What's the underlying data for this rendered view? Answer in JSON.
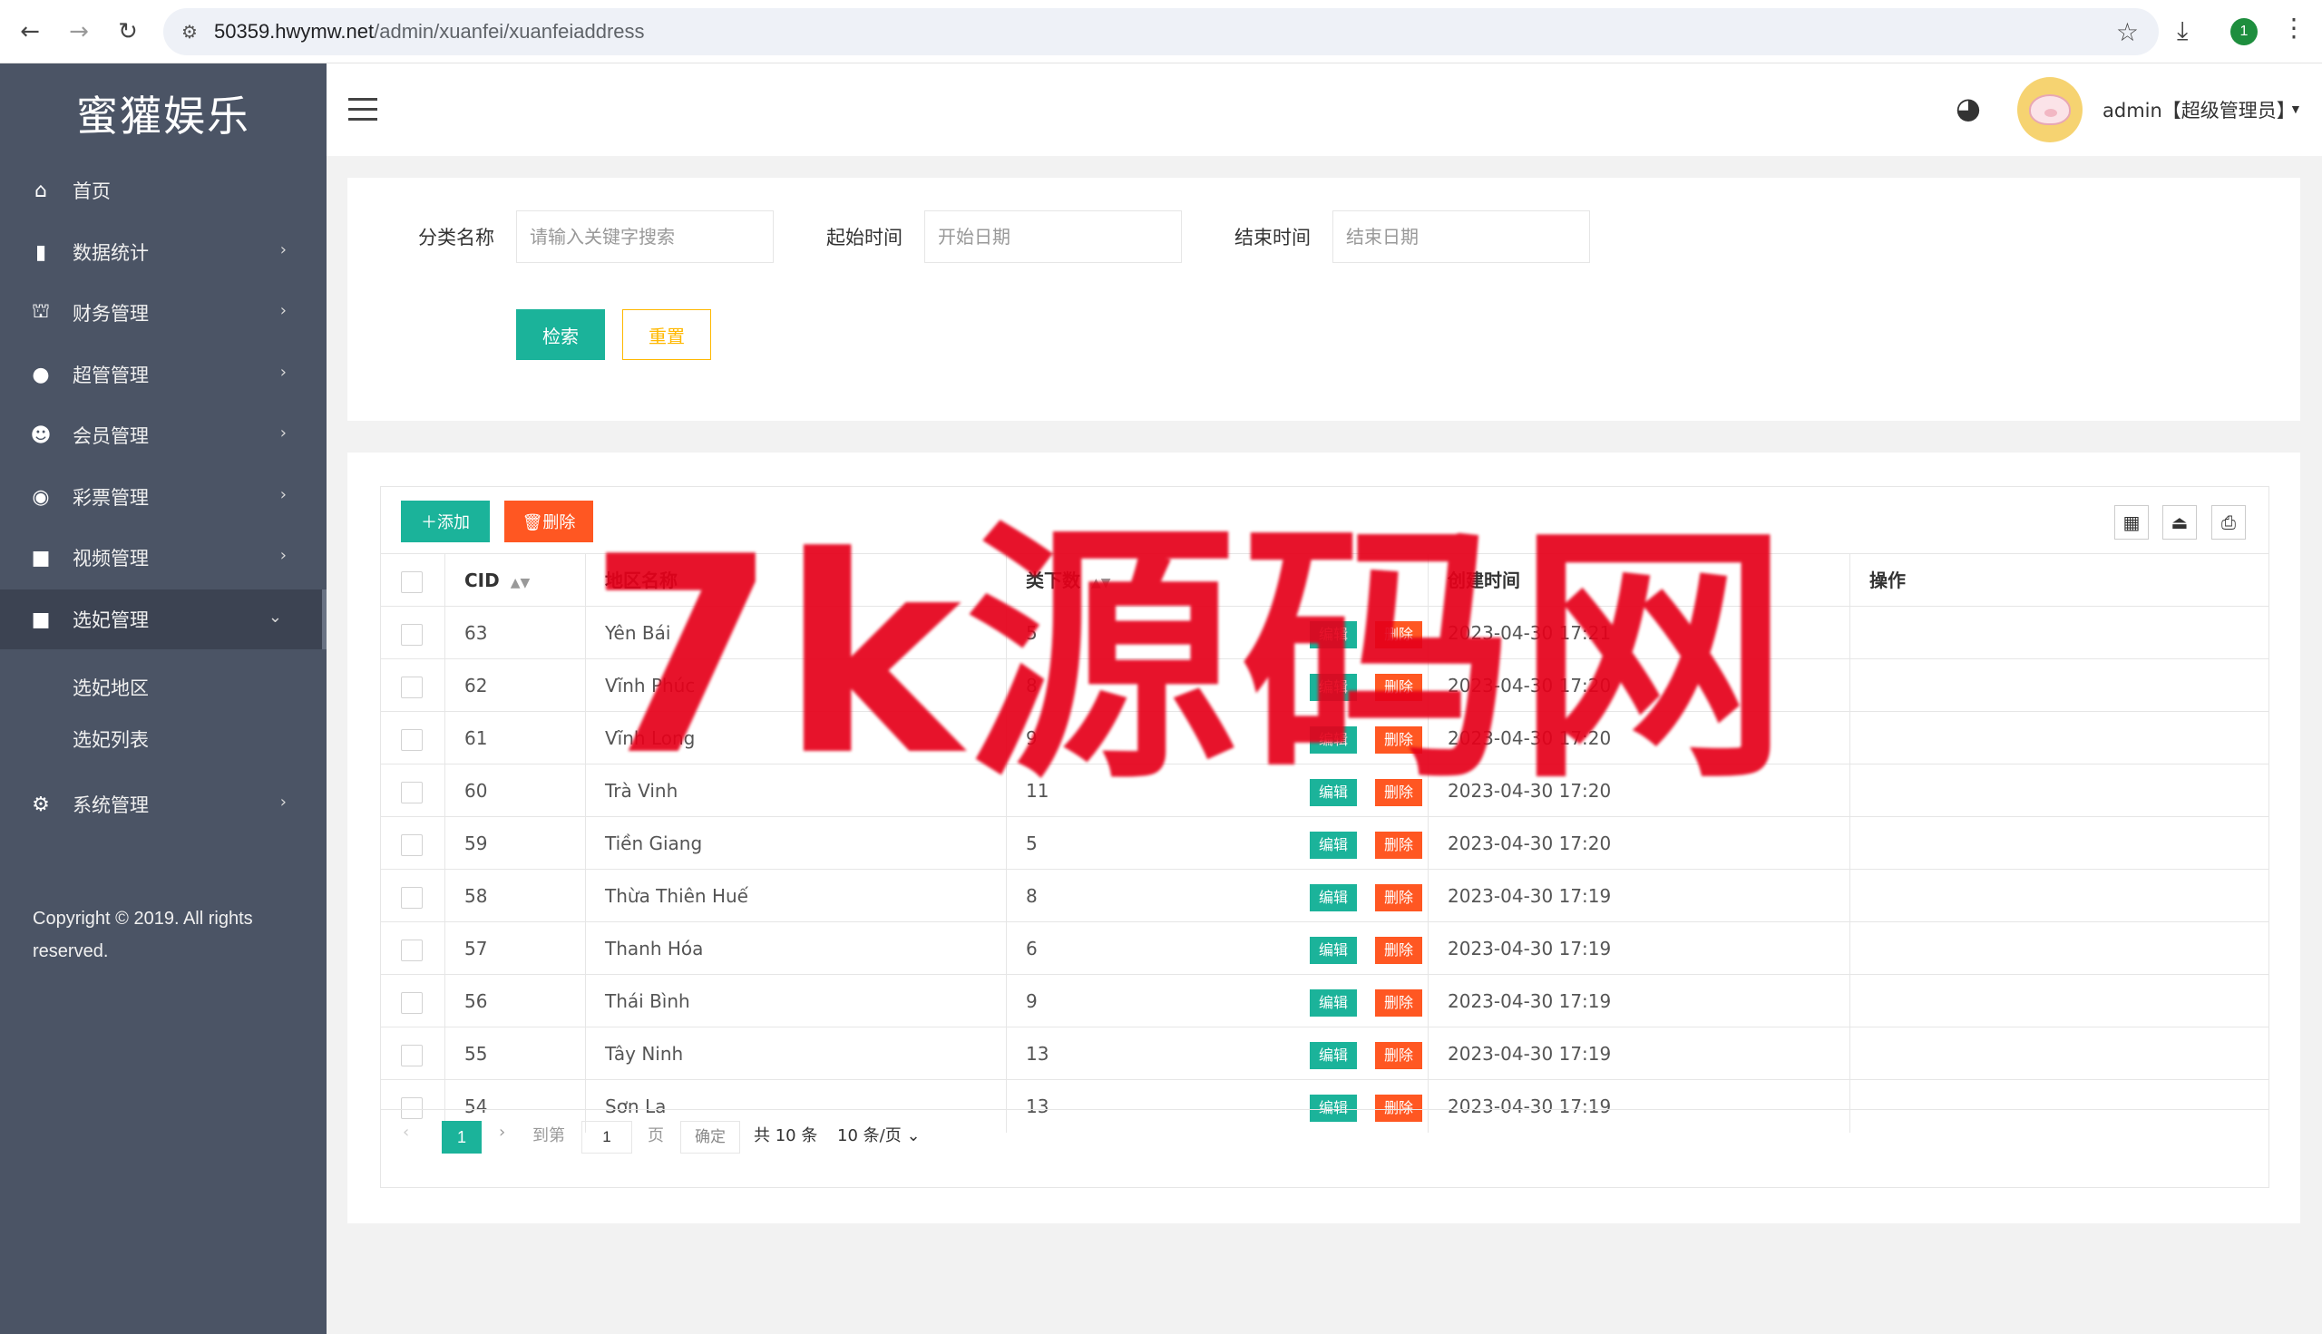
{
  "browser": {
    "url_host": "50359.hwymw.net",
    "url_path": "/admin/xuanfei/xuanfeiaddress",
    "profile_badge": "1"
  },
  "sidebar": {
    "logo": "蜜獾娱乐",
    "items": [
      {
        "label": "首页",
        "icon": "home-icon",
        "glyph": "⌂"
      },
      {
        "label": "数据统计",
        "icon": "bar-chart-icon",
        "glyph": "▮"
      },
      {
        "label": "财务管理",
        "icon": "bank-icon",
        "glyph": "⛫"
      },
      {
        "label": "超管管理",
        "icon": "user-icon",
        "glyph": "●"
      },
      {
        "label": "会员管理",
        "icon": "users-icon",
        "glyph": "☻"
      },
      {
        "label": "彩票管理",
        "icon": "gamepad-icon",
        "glyph": "◉"
      },
      {
        "label": "视频管理",
        "icon": "video-camera-icon",
        "glyph": "■"
      },
      {
        "label": "选妃管理",
        "icon": "video-camera-icon",
        "glyph": "■"
      },
      {
        "label": "系统管理",
        "icon": "gear-icon",
        "glyph": "⚙"
      }
    ],
    "sub_items": [
      "选妃地区",
      "选妃列表"
    ],
    "copyright": "Copyright © 2019. All rights reserved."
  },
  "header": {
    "admin_label": "admin【超级管理员】"
  },
  "search": {
    "category_label": "分类名称",
    "category_placeholder": "请输入关键字搜索",
    "start_label": "起始时间",
    "start_placeholder": "开始日期",
    "end_label": "结束时间",
    "end_placeholder": "结束日期",
    "search_button": "检索",
    "reset_button": "重置"
  },
  "toolbar": {
    "add_button": "＋添加",
    "delete_button": "🗑删除"
  },
  "table": {
    "columns": [
      "CID",
      "地区名称",
      "类下数",
      "创建时间",
      "操作"
    ],
    "edit_label": "编辑",
    "delete_label": "删除",
    "rows": [
      {
        "cid": "63",
        "name": "Yên Bái",
        "count": "5",
        "created": "2023-04-30 17:21"
      },
      {
        "cid": "62",
        "name": "Vĩnh Phúc",
        "count": "8",
        "created": "2023-04-30 17:20"
      },
      {
        "cid": "61",
        "name": "Vĩnh Long",
        "count": "9",
        "created": "2023-04-30 17:20"
      },
      {
        "cid": "60",
        "name": "Trà Vinh",
        "count": "11",
        "created": "2023-04-30 17:20"
      },
      {
        "cid": "59",
        "name": "Tiền Giang",
        "count": "5",
        "created": "2023-04-30 17:20"
      },
      {
        "cid": "58",
        "name": "Thừa Thiên Huế",
        "count": "8",
        "created": "2023-04-30 17:19"
      },
      {
        "cid": "57",
        "name": "Thanh Hóa",
        "count": "6",
        "created": "2023-04-30 17:19"
      },
      {
        "cid": "56",
        "name": "Thái Bình",
        "count": "9",
        "created": "2023-04-30 17:19"
      },
      {
        "cid": "55",
        "name": "Tây Ninh",
        "count": "13",
        "created": "2023-04-30 17:19"
      },
      {
        "cid": "54",
        "name": "Sơn La",
        "count": "13",
        "created": "2023-04-30 17:19"
      }
    ]
  },
  "pager": {
    "current_page": "1",
    "goto_prefix": "到第",
    "goto_value": "1",
    "goto_suffix": "页",
    "confirm": "确定",
    "total": "共 10 条",
    "page_size": "10 条/页"
  },
  "watermark": "7k源码网"
}
